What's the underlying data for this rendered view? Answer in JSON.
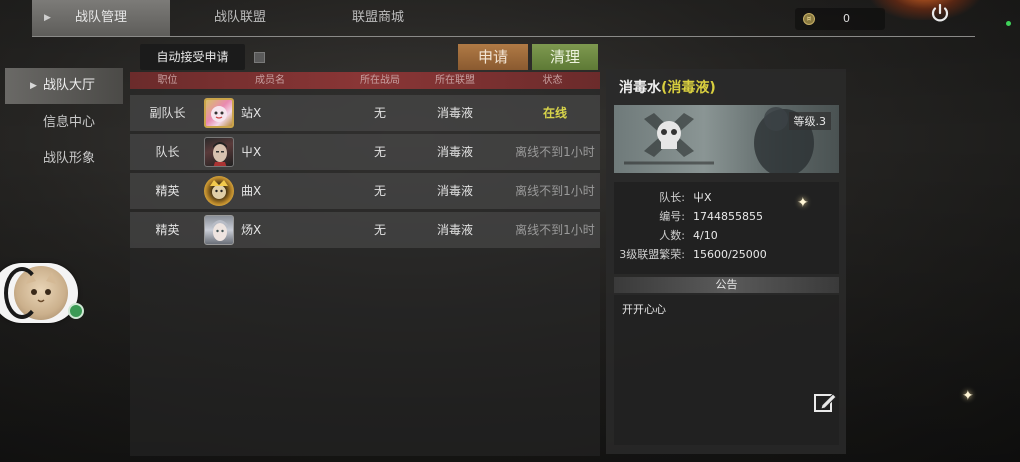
{
  "top_tabs": [
    {
      "label": "战队管理",
      "active": true
    },
    {
      "label": "战队联盟",
      "active": false
    },
    {
      "label": "联盟商城",
      "active": false
    }
  ],
  "currency": {
    "value": "0",
    "icon": "coin-icon"
  },
  "sidebar": {
    "items": [
      {
        "label": "战队大厅",
        "active": true
      },
      {
        "label": "信息中心",
        "active": false
      },
      {
        "label": "战队形象",
        "active": false
      }
    ]
  },
  "controls": {
    "auto_accept_label": "自动接受申请",
    "apply_label": "申请",
    "clean_label": "清理"
  },
  "table": {
    "headers": [
      "职位",
      "成员名",
      "所在战局",
      "所在联盟",
      "状态"
    ],
    "rows": [
      {
        "position": "副队长",
        "name": "站X",
        "match": "无",
        "alliance": "消毒液",
        "status": "在线",
        "online": true
      },
      {
        "position": "队长",
        "name": "屮X",
        "match": "无",
        "alliance": "消毒液",
        "status": "离线不到1小时",
        "online": false
      },
      {
        "position": "精英",
        "name": "曲X",
        "match": "无",
        "alliance": "消毒液",
        "status": "离线不到1小时",
        "online": false
      },
      {
        "position": "精英",
        "name": "炀X",
        "match": "无",
        "alliance": "消毒液",
        "status": "离线不到1小时",
        "online": false
      }
    ]
  },
  "info": {
    "team_name": "消毒水",
    "alliance_paren": "(消毒液)",
    "level": "等级.3",
    "rows": [
      {
        "label": "队长:",
        "value": "屮X"
      },
      {
        "label": "编号:",
        "value": "1744855855"
      },
      {
        "label": "人数:",
        "value": "4/10"
      },
      {
        "label": "3级联盟繁荣:",
        "value": "15600/25000"
      }
    ],
    "notice_title": "公告",
    "notice_text": "开开心心"
  },
  "colors": {
    "online": "#d8d44a",
    "offline": "#9a9a9a",
    "header_red": "#8a3636",
    "apply_btn": "#b07a45",
    "clean_btn": "#7e9950"
  }
}
